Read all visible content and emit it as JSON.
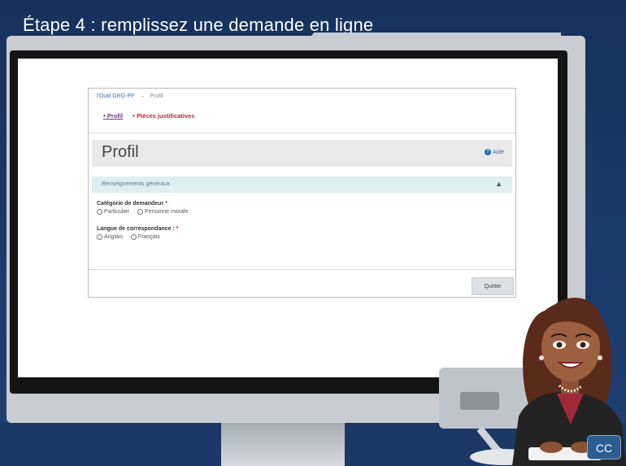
{
  "slide": {
    "title": "Étape 4 : remplissez une demande en ligne"
  },
  "breadcrumb": {
    "root": "l'Outil GRG-PF",
    "separator": "→",
    "current": "Profil"
  },
  "steps": [
    {
      "label": "Profil"
    },
    {
      "label": "Pièces justificatives"
    }
  ],
  "page": {
    "title": "Profil",
    "help_label": "Aide"
  },
  "section": {
    "title": "Renseignements généraux"
  },
  "fields": {
    "requester_category": {
      "label": "Catégorie de demandeur",
      "required_mark": "*",
      "options": [
        "Particulier",
        "Personne morale"
      ]
    },
    "correspondence_language": {
      "label": "Langue de correspondance :",
      "required_mark": "*",
      "options": [
        "Anglais",
        "Français"
      ]
    }
  },
  "actions": {
    "quit_label": "Quitter"
  },
  "player": {
    "cc_label": "CC"
  },
  "colors": {
    "background": "#1b3b6b",
    "section_bar": "#dfeef0",
    "required": "#c0282d",
    "link": "#3a6fa8"
  }
}
